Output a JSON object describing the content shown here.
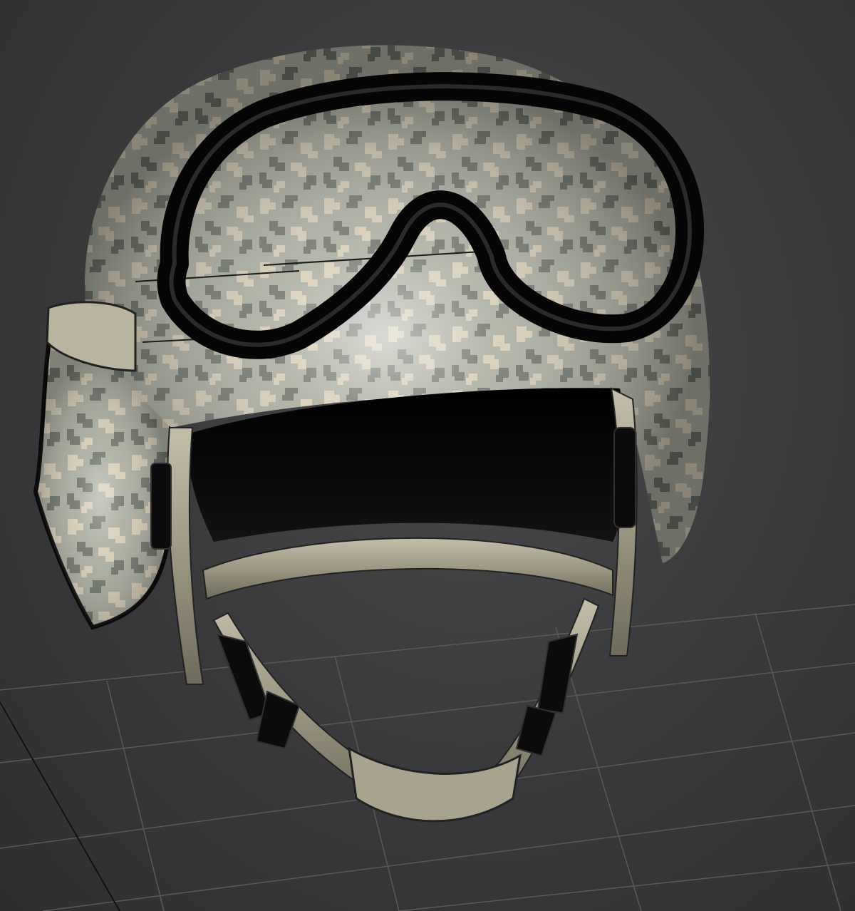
{
  "viewport": {
    "background": "#3b3b3d",
    "grid_color": "#5a5a5c",
    "axis_color": "#111111"
  },
  "model": {
    "object": "helmet",
    "camo_base": "#a9ab9d",
    "camo_light": "#d6ccb4",
    "camo_dark": "#6c7268",
    "goggles_color": "#0b0b0b",
    "strap_color": "#a29d88"
  }
}
